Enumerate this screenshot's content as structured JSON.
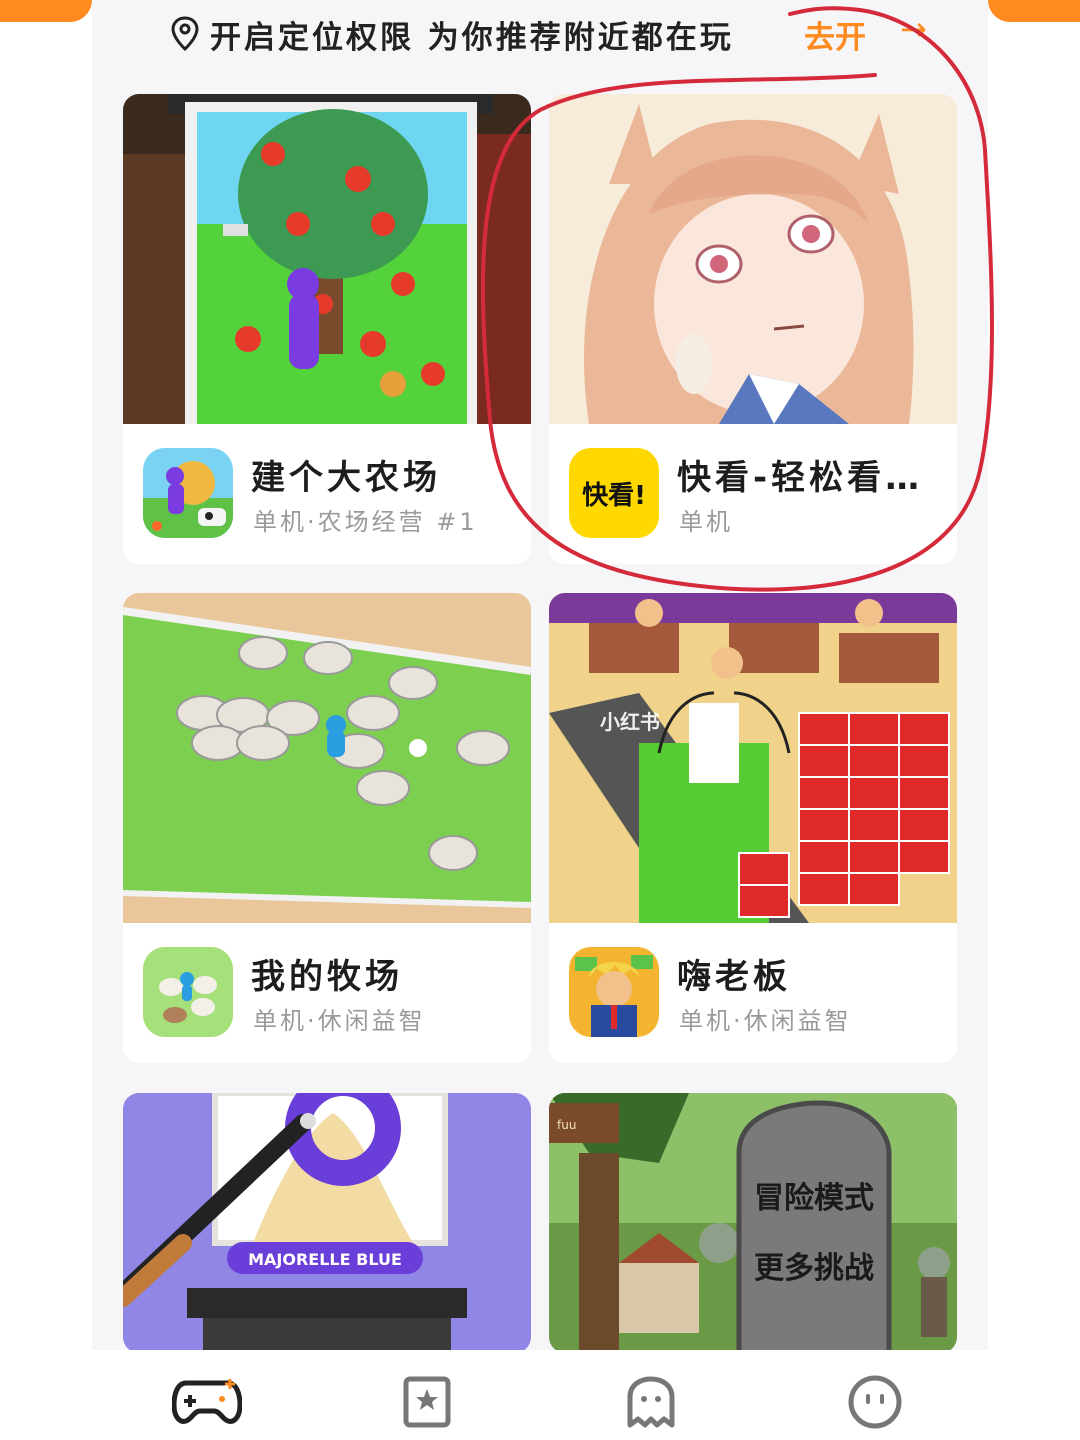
{
  "banner": {
    "text": "开启定位权限 为你推荐附近都在玩",
    "action": "去开",
    "arrow": "→",
    "icon": "location-pin-icon"
  },
  "cards": [
    {
      "name": "建个大农场",
      "tags": "单机·农场经营 #1",
      "icon": "farm-game-icon"
    },
    {
      "name": "快看-轻松看…",
      "tags": "单机",
      "icon": "kuaikan-icon",
      "icon_text": "快看!"
    },
    {
      "name": "我的牧场",
      "tags": "单机·休闲益智",
      "icon": "ranch-game-icon"
    },
    {
      "name": "嗨老板",
      "tags": "单机·休闲益智",
      "icon": "boss-game-icon"
    },
    {
      "art_label": "MAJORELLE BLUE"
    },
    {
      "art_sign": "冒险模式",
      "art_sign2": "更多挑战",
      "art_post": "fuu"
    }
  ],
  "watermark": "小红书",
  "nav": [
    {
      "icon": "gamepad-icon"
    },
    {
      "icon": "star-bookmark-icon"
    },
    {
      "icon": "ghost-icon"
    },
    {
      "icon": "smiley-profile-icon"
    }
  ],
  "colors": {
    "accent": "#ff8a1f",
    "annotation": "#d42a3a"
  }
}
